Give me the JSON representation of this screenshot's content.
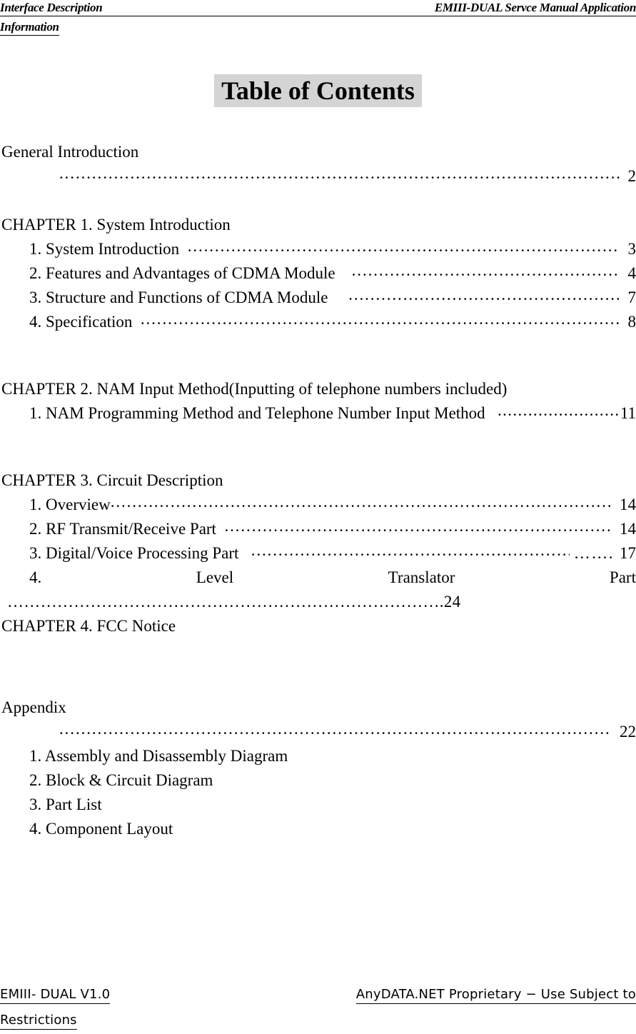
{
  "header": {
    "left": "Interface Description",
    "right": "EMIII-DUAL Servce Manual Application",
    "continuation": "Information"
  },
  "title": "Table of Contents",
  "toc": {
    "general": {
      "heading": "General Introduction",
      "page": "2"
    },
    "chapter1": {
      "heading": "CHAPTER 1. System Introduction",
      "entries": [
        {
          "label": "1. System Introduction",
          "page": "3"
        },
        {
          "label": "2. Features and Advantages of CDMA Module",
          "page": "4"
        },
        {
          "label": "3. Structure and Functions of CDMA Module",
          "page": "7"
        },
        {
          "label": "4. Specification",
          "page": "8"
        }
      ]
    },
    "chapter2": {
      "heading": "CHAPTER 2. NAM Input Method(Inputting of telephone numbers included)",
      "entries": [
        {
          "label": "1. NAM Programming Method and Telephone Number Input Method",
          "page": "11"
        }
      ]
    },
    "chapter3": {
      "heading": "CHAPTER 3. Circuit Description",
      "entries": [
        {
          "label": "1. Overview",
          "page": "14"
        },
        {
          "label": "2. RF Transmit/Receive Part",
          "page": "14"
        },
        {
          "label": "3. Digital/Voice Processing Part",
          "page": "17",
          "extra_leader": "……."
        }
      ],
      "spread_entry": {
        "number": "4.",
        "word1": "Level",
        "word2": "Translator",
        "word3": "Part"
      },
      "spread_entry_leader": "…………………………………………………………………….24"
    },
    "chapter4": {
      "heading": "CHAPTER 4. FCC Notice"
    },
    "appendix": {
      "heading": "Appendix",
      "page": "22",
      "entries": [
        {
          "label": "1. Assembly and Disassembly Diagram"
        },
        {
          "label": "2. Block & Circuit Diagram"
        },
        {
          "label": "3. Part List"
        },
        {
          "label": "4. Component Layout"
        }
      ]
    }
  },
  "footer": {
    "left": "EMIII- DUAL  V1.0",
    "right": "AnyDATA.NET  Proprietary  −   Use  Subject  to",
    "continuation": "Restrictions"
  }
}
